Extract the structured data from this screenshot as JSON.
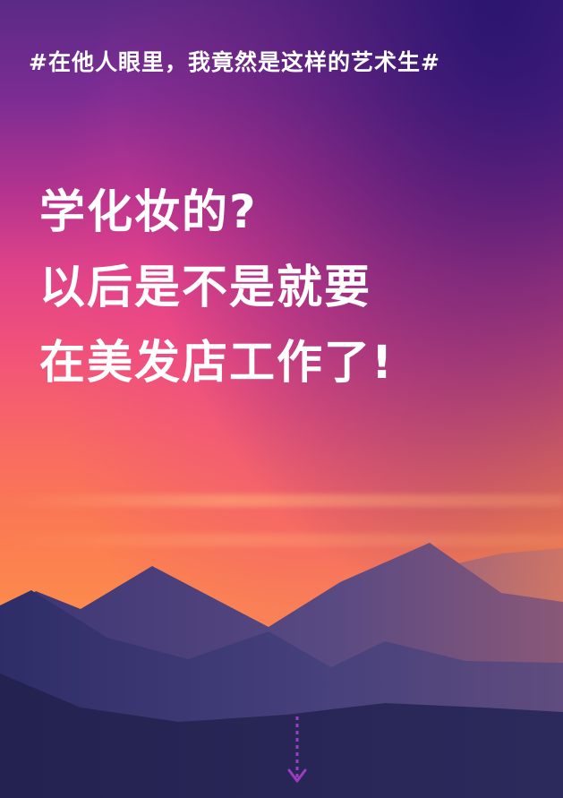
{
  "hashtag": "#在他人眼里，我竟然是这样的艺术生#",
  "headline": {
    "line1": "学化妆的?",
    "line2": "以后是不是就要",
    "line3": "在美发店工作了!"
  },
  "colors": {
    "text": "#ffffff",
    "arrow": "#9b3cc3",
    "sky_top": "#5b2a86",
    "sky_mid": "#e04388",
    "sky_bottom": "#fb8f50",
    "mountain_dark": "#1f1f4a",
    "mountain_mid": "#3f3f78",
    "mountain_light": "#5f4a84"
  },
  "icons": {
    "scroll_hint": "arrow-down-icon"
  }
}
